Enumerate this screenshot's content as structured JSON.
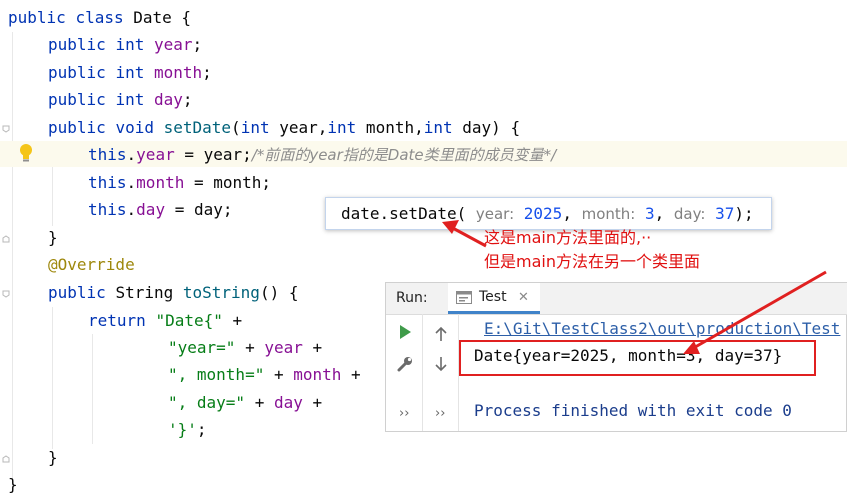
{
  "editor": {
    "line1": {
      "kw1": "public",
      "kw2": "class",
      "name": "Date",
      "brace": " {"
    },
    "line2": {
      "kw1": "public",
      "type": "int",
      "field": "year",
      "end": ";"
    },
    "line3": {
      "kw1": "public",
      "type": "int",
      "field": "month",
      "end": ";"
    },
    "line4": {
      "kw1": "public",
      "type": "int",
      "field": "day",
      "end": ";"
    },
    "line5": {
      "kw1": "public",
      "kw2": "void",
      "method": "setDate",
      "open": "(",
      "p1type": "int",
      "p1": " year,",
      "p2type": "int",
      "p2": " month,",
      "p3type": "int",
      "p3": " day) {"
    },
    "line6": {
      "this": "this",
      "dot": ".",
      "field": "year",
      "rest": " = year;",
      "comment": "/*前面的year指的是Date类里面的成员变量*/"
    },
    "line7": {
      "this": "this",
      "dot": ".",
      "field": "month",
      "rest": " = month;"
    },
    "line8": {
      "this": "this",
      "dot": ".",
      "field": "day",
      "rest": " = day;"
    },
    "line9": {
      "text": "}"
    },
    "line10": {
      "annotation": "@Override"
    },
    "line11": {
      "kw1": "public",
      "type": "String",
      "method": "toString",
      "rest": "() {"
    },
    "line12": {
      "kw": "return",
      "str": "\"Date{\"",
      "rest": " +"
    },
    "line13": {
      "str": "\"year=\"",
      "op": " + ",
      "field": "year",
      "rest": " +"
    },
    "line14": {
      "str": "\", month=\"",
      "op": " + ",
      "field": "month",
      "rest": " +"
    },
    "line15": {
      "str": "\", day=\"",
      "op": " + ",
      "field": "day",
      "rest": " +"
    },
    "line16": {
      "str": "'}'",
      "rest": ";"
    },
    "line17": {
      "text": "}"
    },
    "line18": {
      "text": "}"
    }
  },
  "hint": {
    "call": "date.setDate(",
    "p1_name": "year:",
    "p1_value": "2025",
    "p2_name": "month:",
    "p2_value": "3",
    "p3_name": "day:",
    "p3_value": "37",
    "end": ");",
    "sep": ", "
  },
  "notes": {
    "line1": "这是main方法里面的,··",
    "line2": "但是main方法在另一个类里面"
  },
  "run_panel": {
    "label": "Run:",
    "tab": "Test",
    "tab_close": "✕",
    "more": "››",
    "console": {
      "command": "E:\\Git\\TestClass2\\out\\production\\Test",
      "output": "Date{year=2025, month=3, day=37}",
      "process": "Process finished with exit code 0"
    }
  },
  "icons": [
    "lightbulb-icon",
    "fold-marker-icon",
    "run-icon",
    "wrench-icon",
    "arrow-up-icon",
    "arrow-down-icon",
    "console-tab-icon"
  ],
  "colors": {
    "keyword": "#0033b3",
    "field": "#871094",
    "method": "#00627a",
    "string": "#067d17",
    "annotation": "#9e880d",
    "comment": "#8c8c8c",
    "number": "#1750eb",
    "red_markup": "#e02020"
  }
}
